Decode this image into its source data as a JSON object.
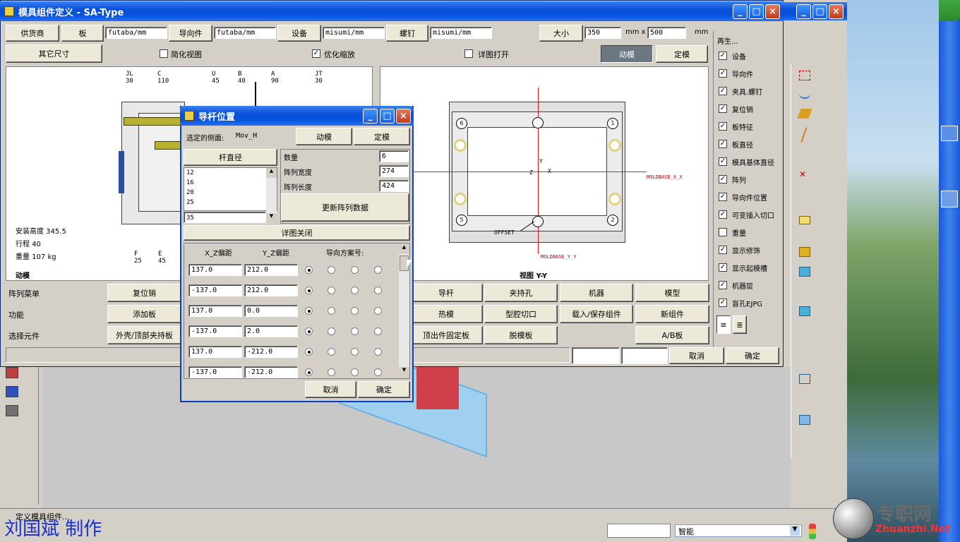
{
  "main_window": {
    "title": "模具组件定义 - SA-Type"
  },
  "row1": {
    "supplier_label": "供货商",
    "plate_btn": "板",
    "plate_val": "futaba/mm",
    "guide_btn": "导向件",
    "guide_val": "futaba/mm",
    "equip_btn": "设备",
    "equip_val": "misumi/mm",
    "screw_btn": "螺钉",
    "screw_val": "misumi/mm",
    "size_btn": "大小",
    "size_w": "350",
    "mm_x": "mm x",
    "size_h": "500",
    "mm": "mm"
  },
  "row2": {
    "other_size": "其它尺寸",
    "simplify": "简化视图",
    "optimize": "优化缩放",
    "detail_open": "详图打开",
    "moving": "动模",
    "fixed": "定模"
  },
  "left_view": {
    "top_labels": [
      {
        "name": "JL",
        "val": "30"
      },
      {
        "name": "C",
        "val": "110"
      },
      {
        "name": "U",
        "val": "45"
      },
      {
        "name": "B",
        "val": "40"
      },
      {
        "name": "A",
        "val": "90"
      },
      {
        "name": "JT",
        "val": "30"
      }
    ],
    "bottom_labels": [
      {
        "name": "F",
        "val": "25"
      },
      {
        "name": "E",
        "val": "45"
      }
    ],
    "install_height": "安装高度 345.5",
    "stroke": "行程 40",
    "weight": "重量 107 kg",
    "caption": "动模"
  },
  "right_view": {
    "caption": "视图 Y-Y",
    "offset_label": "OFFSET",
    "moldbase_x": "MOLDBASE_X_X",
    "moldbase_y": "MOLDBASE_Y_Y",
    "axis_y": "Y",
    "axis_x": "X",
    "axis_z": "Z",
    "circle_nums": [
      "6",
      "1",
      "5",
      "2"
    ]
  },
  "bottom_rows": [
    {
      "label": "阵列菜单",
      "buttons": [
        "复位销",
        "导杆",
        "夹持孔",
        "机器",
        "模型"
      ]
    },
    {
      "label": "功能",
      "buttons": [
        "添加板",
        "热模",
        "型腔切口",
        "载入/保存组件",
        "新组件"
      ]
    },
    {
      "label": "选择元件",
      "buttons": [
        "外壳/顶部夹持板",
        "顶出件固定板",
        "脱模板",
        "A/B板"
      ]
    }
  ],
  "footer": {
    "cancel": "取消",
    "ok": "确定"
  },
  "side_panel": {
    "title": "再生...",
    "items": [
      {
        "label": "设备",
        "checked": true
      },
      {
        "label": "导向件",
        "checked": true
      },
      {
        "label": "夹具.螺钉",
        "checked": true
      },
      {
        "label": "复位销",
        "checked": true
      },
      {
        "label": "板特征",
        "checked": true
      },
      {
        "label": "板直径",
        "checked": true
      },
      {
        "label": "模具基体直径",
        "checked": true
      },
      {
        "label": "阵列",
        "checked": true
      },
      {
        "label": "导向件位置",
        "checked": true
      },
      {
        "label": "可变插入切口",
        "checked": true
      },
      {
        "label": "重量",
        "checked": false
      },
      {
        "label": "显示修饰",
        "checked": true
      },
      {
        "label": "显示起模槽",
        "checked": true
      },
      {
        "label": "机器层",
        "checked": true
      },
      {
        "label": "盲孔EJPG",
        "checked": true
      }
    ]
  },
  "dialog": {
    "title": "导杆位置",
    "selected_side_label": "选定的侧面:",
    "selected_side_val": "Mov_H",
    "moving_btn": "动模",
    "fixed_btn": "定模",
    "rod_diam_btn": "杆直径",
    "diam_list": [
      "12",
      "16",
      "20",
      "25"
    ],
    "diam_selected": "35",
    "qty_label": "数量",
    "qty_val": "6",
    "width_label": "阵列宽度",
    "width_val": "274",
    "length_label": "阵列长度",
    "length_val": "424",
    "update_btn": "更新阵列数据",
    "detail_close": "详图关闭",
    "col_x": "X_Z偏距",
    "col_y": "Y_Z偏距",
    "col_dir": "导向方案号:",
    "rows": [
      {
        "x": "137.0",
        "y": "212.0"
      },
      {
        "x": "-137.0",
        "y": "212.0"
      },
      {
        "x": "137.0",
        "y": "0.0"
      },
      {
        "x": "-137.0",
        "y": "2.0"
      },
      {
        "x": "137.0",
        "y": "-212.0"
      },
      {
        "x": "-137.0",
        "y": "-212.0"
      }
    ],
    "cancel": "取消",
    "ok": "确定"
  },
  "bg_window": {
    "status": "定义模具组件..."
  },
  "watermark": {
    "author": "刘国斌 制作",
    "site_cn": "专职网",
    "site_en": "Zhuanzhi.Net"
  },
  "taskbar": {
    "ime": "智能"
  }
}
